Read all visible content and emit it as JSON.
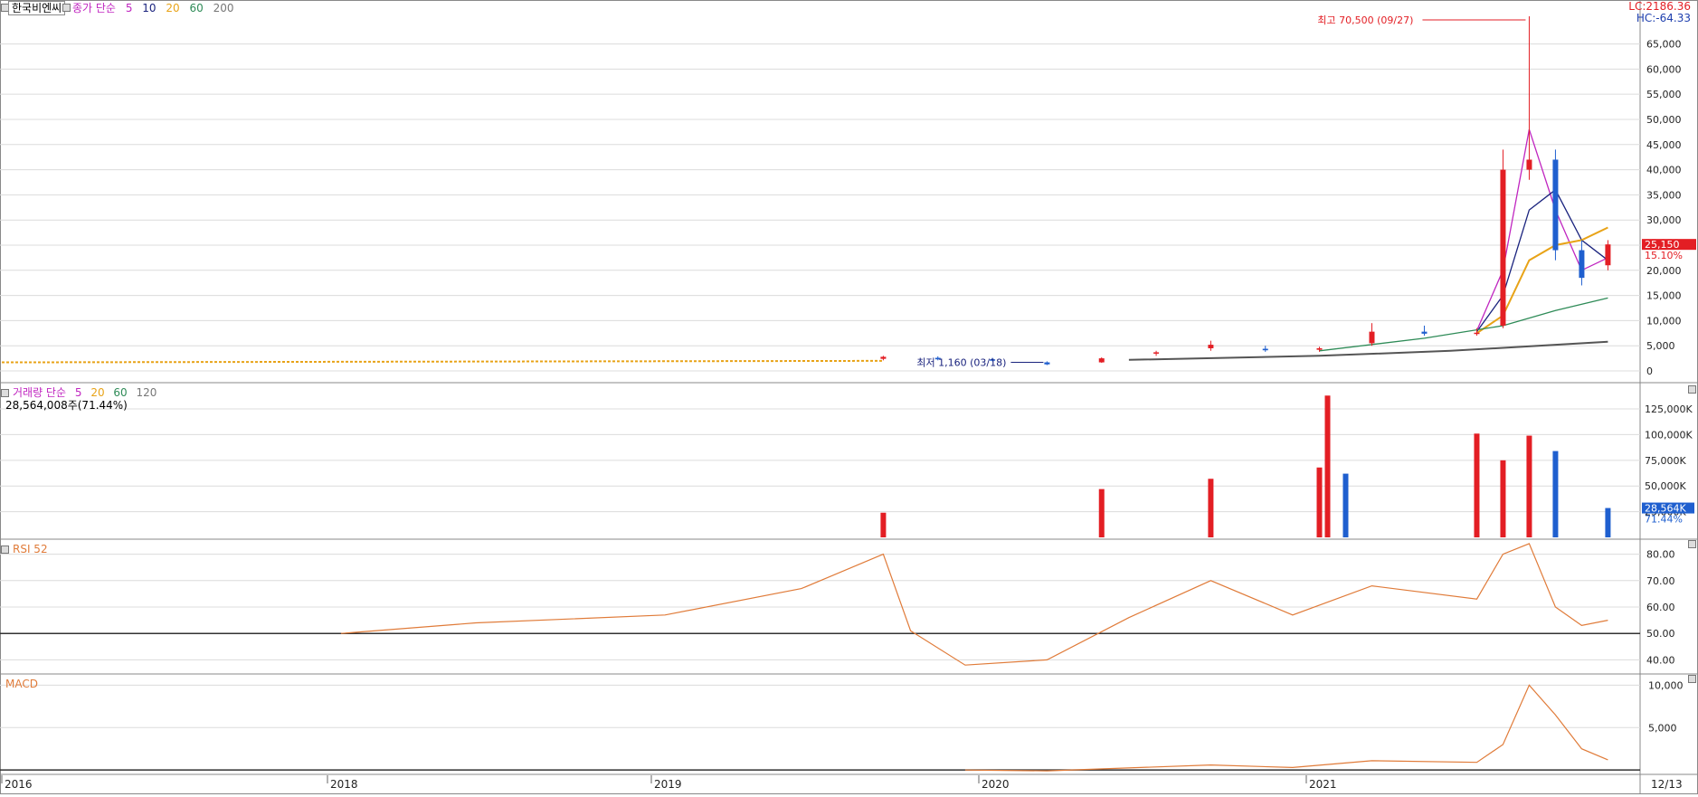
{
  "header": {
    "stock_name": "한국비엔씨",
    "price_legend_prefix": "종가 단순",
    "ma_periods": [
      "5",
      "10",
      "20",
      "60",
      "200"
    ],
    "lc_label": "LC:2186.36",
    "hc_label": "HC:-64.33"
  },
  "volume_panel": {
    "legend_prefix": "거래량 단순",
    "ma_periods": [
      "5",
      "20",
      "60",
      "120"
    ],
    "current_value": "28,564,008주(71.44%)",
    "last_tag": "28,564K",
    "last_tag_pct": "71.44%"
  },
  "rsi_panel": {
    "legend": "RSI 52"
  },
  "macd_panel": {
    "legend": "MACD"
  },
  "colors": {
    "up": "#e31e24",
    "down": "#1f5fcf",
    "ma5": "#c026c0",
    "ma10": "#1a237e",
    "ma20": "#e8a317",
    "ma60": "#2e8b57",
    "ma200": "#555555",
    "rsi": "#e07b39",
    "macd": "#e07b39",
    "grid": "#dcdcdc"
  },
  "chart_data": [
    {
      "type": "candlestick",
      "x_tick_labels": [
        "2016",
        "2018",
        "2019",
        "2020",
        "2021",
        "12/13"
      ],
      "ylim": [
        0,
        70500
      ],
      "y_ticks": [
        0,
        5000,
        10000,
        15000,
        20000,
        25000,
        30000,
        35000,
        40000,
        45000,
        50000,
        55000,
        60000,
        65000
      ],
      "y_tick_labels": [
        "0",
        "5,000",
        "10,000",
        "15,000",
        "20,000",
        "25,000",
        "30,000",
        "35,000",
        "40,000",
        "45,000",
        "50,000",
        "55,000",
        "60,000",
        "65,000"
      ],
      "last_price_label": "25,150",
      "last_change_label": "15.10%",
      "high_annotation": "최고 70,500 (09/27)",
      "low_annotation": "최저 1,160 (03/18)",
      "candles": [
        {
          "date": "2019-09",
          "open": 2400,
          "high": 3000,
          "low": 2100,
          "close": 2800
        },
        {
          "date": "2019-11",
          "open": 2600,
          "high": 2900,
          "low": 2100,
          "close": 2300
        },
        {
          "date": "2020-01",
          "open": 2300,
          "high": 2600,
          "low": 1900,
          "close": 2100
        },
        {
          "date": "2020-03",
          "open": 1700,
          "high": 1900,
          "low": 1160,
          "close": 1300
        },
        {
          "date": "2020-05",
          "open": 1700,
          "high": 2700,
          "low": 1600,
          "close": 2500
        },
        {
          "date": "2020-07",
          "open": 3500,
          "high": 4000,
          "low": 3000,
          "close": 3700
        },
        {
          "date": "2020-09",
          "open": 4500,
          "high": 6000,
          "low": 4000,
          "close": 5200
        },
        {
          "date": "2020-11",
          "open": 4400,
          "high": 5000,
          "low": 3800,
          "close": 4100
        },
        {
          "date": "2021-01",
          "open": 4200,
          "high": 4800,
          "low": 3800,
          "close": 4500
        },
        {
          "date": "2021-03",
          "open": 5500,
          "high": 9500,
          "low": 5000,
          "close": 7800
        },
        {
          "date": "2021-05",
          "open": 7800,
          "high": 9000,
          "low": 7000,
          "close": 7400
        },
        {
          "date": "2021-07",
          "open": 7400,
          "high": 8500,
          "low": 7000,
          "close": 7600
        },
        {
          "date": "2021-08",
          "open": 9000,
          "high": 44000,
          "low": 8500,
          "close": 40000
        },
        {
          "date": "2021-09",
          "open": 40000,
          "high": 70500,
          "low": 38000,
          "close": 42000
        },
        {
          "date": "2021-10",
          "open": 42000,
          "high": 44000,
          "low": 22000,
          "close": 24000
        },
        {
          "date": "2021-11",
          "open": 24000,
          "high": 26000,
          "low": 17000,
          "close": 18500
        },
        {
          "date": "2021-12",
          "open": 21000,
          "high": 26000,
          "low": 20000,
          "close": 25150
        }
      ],
      "ma_series": [
        {
          "name": "5",
          "color_key": "ma5",
          "values": [
            {
              "date": "2021-07",
              "y": 8000
            },
            {
              "date": "2021-08",
              "y": 20000
            },
            {
              "date": "2021-09",
              "y": 48000
            },
            {
              "date": "2021-10",
              "y": 32000
            },
            {
              "date": "2021-11",
              "y": 20000
            },
            {
              "date": "2021-12",
              "y": 22500
            }
          ]
        },
        {
          "name": "10",
          "color_key": "ma10",
          "values": [
            {
              "date": "2021-07",
              "y": 7800
            },
            {
              "date": "2021-08",
              "y": 15000
            },
            {
              "date": "2021-09",
              "y": 32000
            },
            {
              "date": "2021-10",
              "y": 36000
            },
            {
              "date": "2021-11",
              "y": 26000
            },
            {
              "date": "2021-12",
              "y": 22000
            }
          ]
        },
        {
          "name": "20",
          "color_key": "ma20",
          "values": [
            {
              "date": "2021-07",
              "y": 7500
            },
            {
              "date": "2021-08",
              "y": 11000
            },
            {
              "date": "2021-09",
              "y": 22000
            },
            {
              "date": "2021-10",
              "y": 25000
            },
            {
              "date": "2021-11",
              "y": 26000
            },
            {
              "date": "2021-12",
              "y": 28500
            }
          ]
        },
        {
          "name": "60",
          "color_key": "ma60",
          "values": [
            {
              "date": "2021-01",
              "y": 4000
            },
            {
              "date": "2021-05",
              "y": 6500
            },
            {
              "date": "2021-08",
              "y": 9000
            },
            {
              "date": "2021-10",
              "y": 12000
            },
            {
              "date": "2021-12",
              "y": 14500
            }
          ]
        },
        {
          "name": "200",
          "color_key": "ma200",
          "values": [
            {
              "date": "2020-06",
              "y": 2200
            },
            {
              "date": "2021-01",
              "y": 3000
            },
            {
              "date": "2021-06",
              "y": 4000
            },
            {
              "date": "2021-12",
              "y": 5800
            }
          ]
        }
      ]
    },
    {
      "type": "bar",
      "title": "거래량",
      "ylim": [
        0,
        140000
      ],
      "y_ticks": [
        25000,
        50000,
        75000,
        100000,
        125000
      ],
      "y_tick_labels": [
        "25,000K",
        "50,000K",
        "75,000K",
        "100,000K",
        "125,000K"
      ],
      "bars": [
        {
          "date": "2019-09",
          "value": 24000,
          "dir": "up"
        },
        {
          "date": "2020-05",
          "value": 47000,
          "dir": "up"
        },
        {
          "date": "2020-09",
          "value": 57000,
          "dir": "up"
        },
        {
          "date": "2021-01",
          "value": 68000,
          "dir": "up"
        },
        {
          "date": "2021-01",
          "value": 138000,
          "dir": "up"
        },
        {
          "date": "2021-02",
          "value": 62000,
          "dir": "down"
        },
        {
          "date": "2021-07",
          "value": 101000,
          "dir": "up"
        },
        {
          "date": "2021-08",
          "value": 75000,
          "dir": "up"
        },
        {
          "date": "2021-09",
          "value": 99000,
          "dir": "up"
        },
        {
          "date": "2021-10",
          "value": 84000,
          "dir": "down"
        },
        {
          "date": "2021-12",
          "value": 28564,
          "dir": "down"
        }
      ]
    },
    {
      "type": "line",
      "title": "RSI 52",
      "ylim": [
        35,
        85
      ],
      "y_ticks": [
        40,
        50,
        60,
        70,
        80
      ],
      "y_tick_labels": [
        "40.00",
        "50.00",
        "60.00",
        "70.00",
        "80.00"
      ],
      "reference_line": 50,
      "points": [
        {
          "date": "2018-01",
          "y": 50
        },
        {
          "date": "2018-06",
          "y": 54
        },
        {
          "date": "2019-01",
          "y": 57
        },
        {
          "date": "2019-06",
          "y": 67
        },
        {
          "date": "2019-09",
          "y": 80
        },
        {
          "date": "2019-10",
          "y": 51
        },
        {
          "date": "2019-12",
          "y": 38
        },
        {
          "date": "2020-03",
          "y": 40
        },
        {
          "date": "2020-06",
          "y": 56
        },
        {
          "date": "2020-09",
          "y": 70
        },
        {
          "date": "2020-12",
          "y": 57
        },
        {
          "date": "2021-03",
          "y": 68
        },
        {
          "date": "2021-07",
          "y": 63
        },
        {
          "date": "2021-08",
          "y": 80
        },
        {
          "date": "2021-09",
          "y": 84
        },
        {
          "date": "2021-10",
          "y": 60
        },
        {
          "date": "2021-11",
          "y": 53
        },
        {
          "date": "2021-12",
          "y": 55
        }
      ]
    },
    {
      "type": "line",
      "title": "MACD",
      "ylim": [
        0,
        11000
      ],
      "y_ticks": [
        5000,
        10000
      ],
      "y_tick_labels": [
        "5,000",
        "10,000"
      ],
      "points": [
        {
          "date": "2019-12",
          "y": 0
        },
        {
          "date": "2020-03",
          "y": -100
        },
        {
          "date": "2020-09",
          "y": 600
        },
        {
          "date": "2020-12",
          "y": 300
        },
        {
          "date": "2021-03",
          "y": 1100
        },
        {
          "date": "2021-07",
          "y": 900
        },
        {
          "date": "2021-08",
          "y": 3000
        },
        {
          "date": "2021-09",
          "y": 10000
        },
        {
          "date": "2021-10",
          "y": 6500
        },
        {
          "date": "2021-11",
          "y": 2500
        },
        {
          "date": "2021-12",
          "y": 1200
        }
      ]
    }
  ]
}
